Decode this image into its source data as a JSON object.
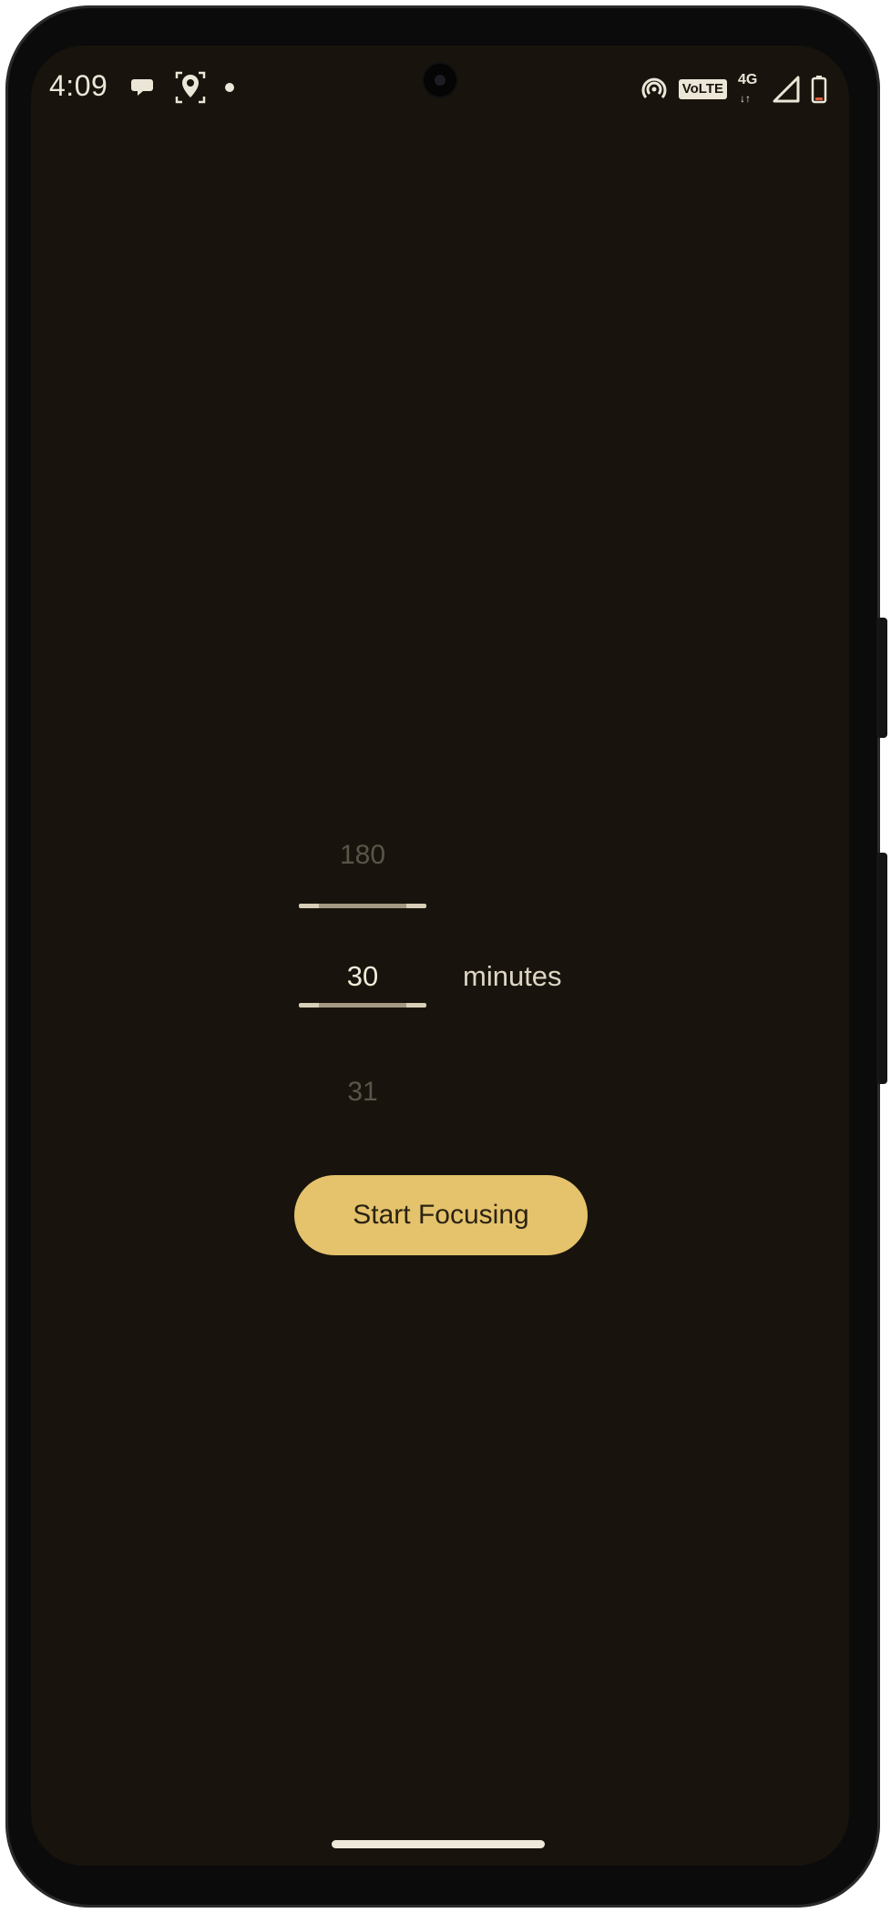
{
  "status_bar": {
    "time": "4:09",
    "left_icons": [
      "chat-bubble-icon",
      "location-pin-icon",
      "dot-icon"
    ],
    "volte": "VoLTE",
    "network": "4G",
    "network_arrows": "↓↑"
  },
  "timer_picker": {
    "previous_value": "180",
    "current_value": "30",
    "next_value": "31",
    "unit": "minutes"
  },
  "actions": {
    "start_label": "Start Focusing"
  },
  "colors": {
    "background": "#18140d",
    "accent": "#e5c36c",
    "text_primary": "#f0ead8",
    "text_muted": "#5a5448"
  }
}
